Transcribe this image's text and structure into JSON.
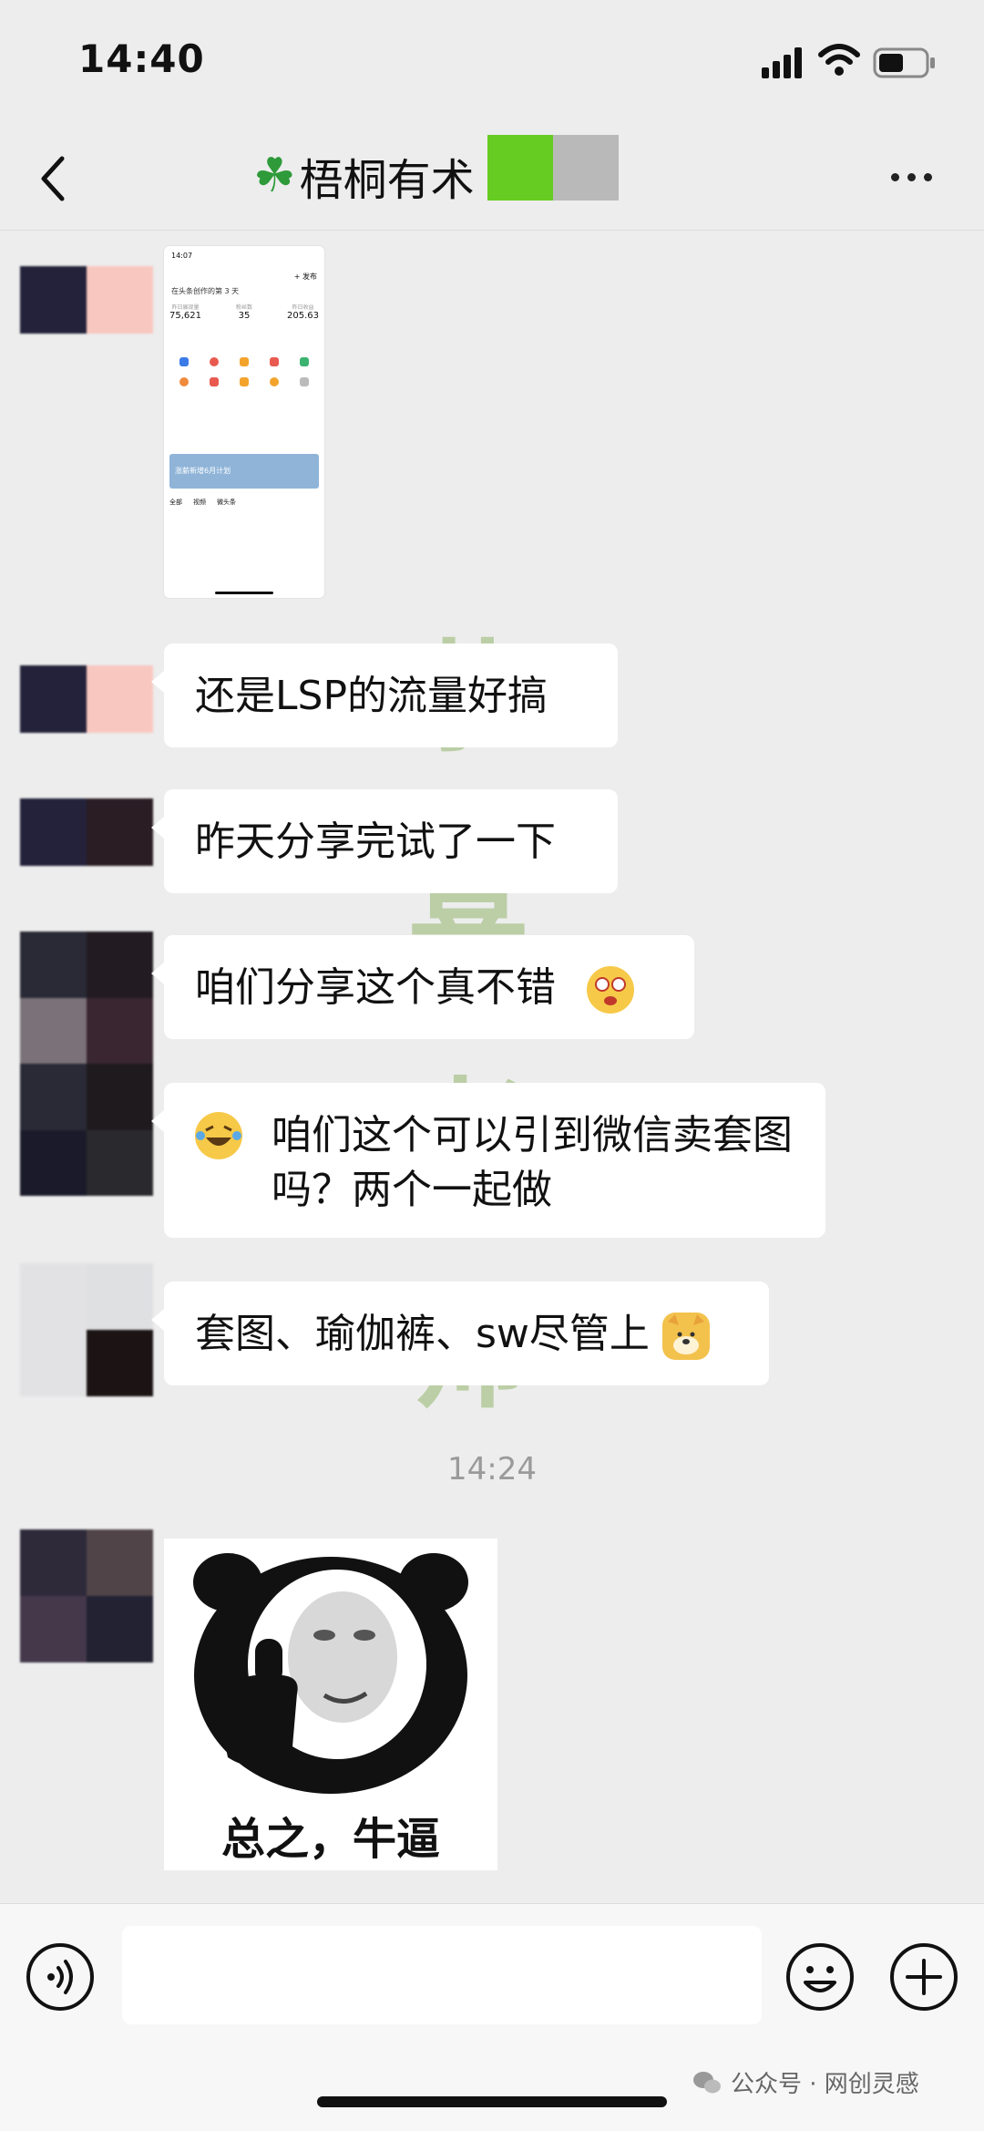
{
  "status": {
    "time": "14:40"
  },
  "nav": {
    "title": "梧桐有术",
    "back_icon": "chevron-left-icon",
    "more_icon": "more-dots-icon"
  },
  "screenshot_preview": {
    "time": "14:07",
    "publish": "+ 发布",
    "heading": "在头条创作的第 3 天",
    "stats": [
      {
        "label": "昨日展现量",
        "value": "75,621"
      },
      {
        "label": "粉丝数",
        "value": "35"
      },
      {
        "label": "昨日收益",
        "value": "205.63"
      }
    ],
    "tabs": [
      "全部",
      "视频",
      "微头条"
    ],
    "banner": "涨薪新增6月计划"
  },
  "messages": [
    {
      "text": "还是LSP的流量好搞"
    },
    {
      "text": "昨天分享完试了一下"
    },
    {
      "text": "咱们分享这个真不错"
    },
    {
      "text": "咱们这个可以引到微信卖套图吗？两个一起做"
    },
    {
      "text": "套图、瑜伽裤、sw尽管上"
    }
  ],
  "timestamp": "14:24",
  "sticker": {
    "caption": "总之，牛逼"
  },
  "watermark": [
    "恭",
    "喜",
    "老",
    "师"
  ],
  "footer": {
    "source": "公众号 · 网创灵感"
  },
  "colors": {
    "bg": "#ededed",
    "bubble": "#ffffff",
    "redact_green": "#66cc22"
  }
}
